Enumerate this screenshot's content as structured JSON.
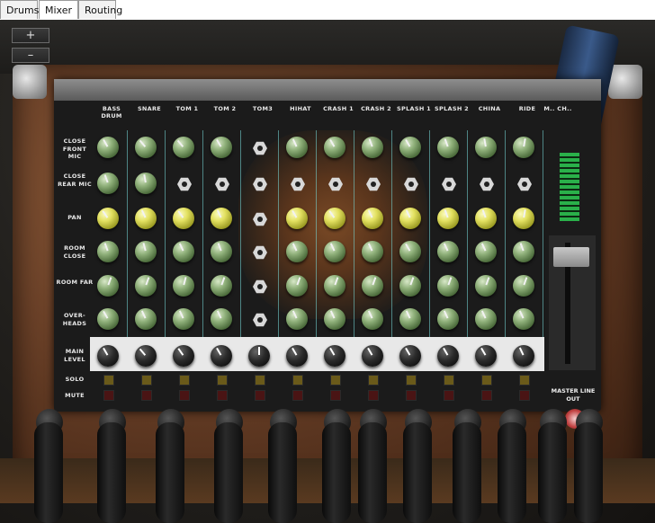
{
  "tabs": [
    {
      "label": "Drums",
      "active": false
    },
    {
      "label": "Mixer",
      "active": true
    },
    {
      "label": "Routing",
      "active": false
    }
  ],
  "zoom": {
    "in_label": "+",
    "out_label": "–"
  },
  "channels": [
    {
      "name": "BASS DRUM"
    },
    {
      "name": "SNARE"
    },
    {
      "name": "TOM 1"
    },
    {
      "name": "TOM 2"
    },
    {
      "name": "TOM3"
    },
    {
      "name": "HIHAT"
    },
    {
      "name": "CRASH 1"
    },
    {
      "name": "CRASH 2"
    },
    {
      "name": "SPLASH 1"
    },
    {
      "name": "SPLASH 2"
    },
    {
      "name": "CHINA"
    },
    {
      "name": "RIDE"
    }
  ],
  "master_channel_head": "M.. CH..",
  "rows": [
    {
      "label": "CLOSE FRONT MIC"
    },
    {
      "label": "CLOSE REAR MIC"
    },
    {
      "label": "PAN"
    },
    {
      "label": "ROOM CLOSE"
    },
    {
      "label": "ROOM FAR"
    },
    {
      "label": "OVER- HEADS"
    },
    {
      "label": "MAIN LEVEL"
    },
    {
      "label": "SOLO"
    },
    {
      "label": "MUTE"
    }
  ],
  "master": {
    "label": "MASTER LINE OUT"
  },
  "colors": {
    "knob_green": "#8fb07a",
    "knob_yellow": "#e2e060",
    "separator": "#78dcdc",
    "case_leather": "#6b4128"
  }
}
